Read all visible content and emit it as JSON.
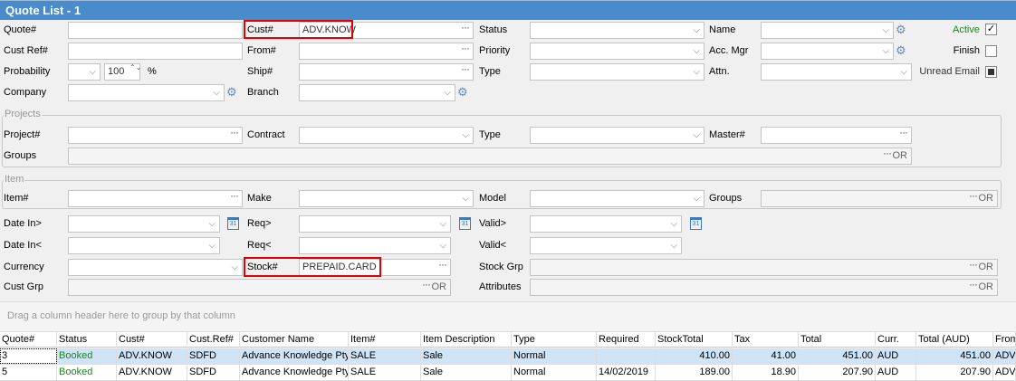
{
  "title": "Quote List - 1",
  "filters": {
    "quote_no": {
      "label": "Quote#",
      "value": ""
    },
    "cust_ref": {
      "label": "Cust Ref#",
      "value": ""
    },
    "probability": {
      "label": "Probability",
      "value": "",
      "percent": "100",
      "unit": "%"
    },
    "company": {
      "label": "Company",
      "value": ""
    },
    "cust_no": {
      "label": "Cust#",
      "value": "ADV.KNOW"
    },
    "from_no": {
      "label": "From#",
      "value": ""
    },
    "ship_no": {
      "label": "Ship#",
      "value": ""
    },
    "branch": {
      "label": "Branch",
      "value": ""
    },
    "status": {
      "label": "Status",
      "value": ""
    },
    "priority": {
      "label": "Priority",
      "value": ""
    },
    "type": {
      "label": "Type",
      "value": ""
    },
    "name": {
      "label": "Name",
      "value": ""
    },
    "acc_mgr": {
      "label": "Acc. Mgr",
      "value": ""
    },
    "attn": {
      "label": "Attn.",
      "value": ""
    },
    "active": {
      "label": "Active",
      "checked": true
    },
    "finish": {
      "label": "Finish",
      "checked": false
    },
    "unread_email": {
      "label": "Unread Email",
      "state": "indeterminate"
    },
    "projects": {
      "group_label": "Projects",
      "project_no": "Project#",
      "contract": "Contract",
      "type": "Type",
      "master_no": "Master#",
      "groups": "Groups",
      "or": "OR"
    },
    "item": {
      "group_label": "Item",
      "item_no": "Item#",
      "make": "Make",
      "model": "Model",
      "groups": "Groups",
      "or": "OR"
    },
    "date_in_gt": {
      "label": "Date In>",
      "value": ""
    },
    "date_in_lt": {
      "label": "Date In<",
      "value": ""
    },
    "req_gt": {
      "label": "Req>",
      "value": ""
    },
    "req_lt": {
      "label": "Req<",
      "value": ""
    },
    "valid_gt": {
      "label": "Valid>",
      "value": ""
    },
    "valid_lt": {
      "label": "Valid<",
      "value": ""
    },
    "currency": {
      "label": "Currency",
      "value": ""
    },
    "stock_no": {
      "label": "Stock#",
      "value": "PREPAID.CARD"
    },
    "stock_grp": {
      "label": "Stock Grp",
      "or": "OR"
    },
    "cust_grp": {
      "label": "Cust Grp",
      "or": "OR"
    },
    "attributes": {
      "label": "Attributes",
      "or": "OR"
    },
    "calendar_day": "31"
  },
  "group_panel_hint": "Drag a column header here to group by that column",
  "grid": {
    "columns": [
      "Quote#",
      "Status",
      "Cust#",
      "Cust.Ref#",
      "Customer Name",
      "Item#",
      "Item Description",
      "Type",
      "Required",
      "StockTotal",
      "Tax",
      "Total",
      "Curr.",
      "Total (AUD)",
      "From"
    ],
    "rows": [
      [
        "3",
        "Booked",
        "ADV.KNOW",
        "SDFD",
        "Advance Knowledge Pty",
        "SALE",
        "Sale",
        "Normal",
        "",
        "410.00",
        "41.00",
        "451.00",
        "AUD",
        "451.00",
        "ADV"
      ],
      [
        "5",
        "Booked",
        "ADV.KNOW",
        "SDFD",
        "Advance Knowledge Pty",
        "SALE",
        "Sale",
        "Normal",
        "14/02/2019",
        "189.00",
        "18.90",
        "207.90",
        "AUD",
        "207.90",
        "ADV"
      ]
    ]
  },
  "colors": {
    "title_bar": "#4a8ccb",
    "highlight": "#e00000",
    "status_booked": "#1a8a1a",
    "selected_row": "#cfe4f6"
  }
}
